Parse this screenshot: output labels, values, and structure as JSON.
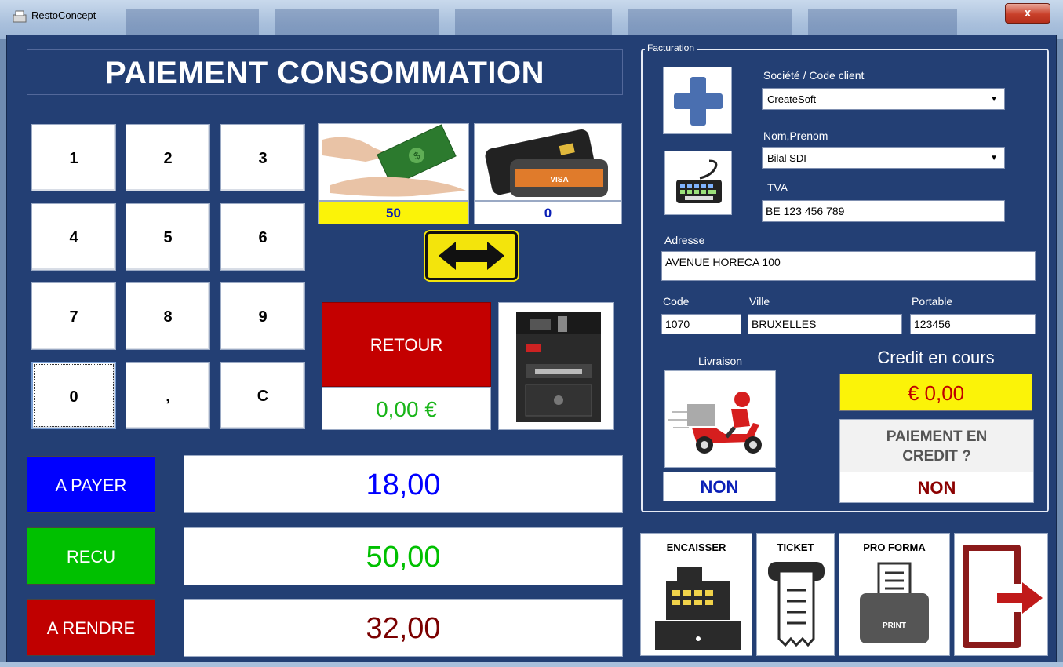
{
  "window": {
    "title": "RestoConcept",
    "close_glyph": "x"
  },
  "page_title": "PAIEMENT CONSOMMATION",
  "keypad": [
    "1",
    "2",
    "3",
    "4",
    "5",
    "6",
    "7",
    "8",
    "9",
    "0",
    ",",
    "C"
  ],
  "payment": {
    "cash_value": "50",
    "card_value": "0",
    "card_brand": "VISA",
    "retour_label": "RETOUR",
    "retour_value": "0,00 €"
  },
  "totals": {
    "a_payer_label": "A PAYER",
    "a_payer_value": "18,00",
    "recu_label": "RECU",
    "recu_value": "50,00",
    "a_rendre_label": "A RENDRE",
    "a_rendre_value": "32,00"
  },
  "facturation": {
    "legend": "Facturation",
    "societe_label": "Société / Code client",
    "societe_value": "CreateSoft",
    "nom_label": "Nom,Prenom",
    "nom_value": "Bilal SDI",
    "tva_label": "TVA",
    "tva_value": "BE 123 456 789",
    "adresse_label": "Adresse",
    "adresse_value": "AVENUE HORECA 100",
    "code_label": "Code",
    "code_value": "1070",
    "ville_label": "Ville",
    "ville_value": "BRUXELLES",
    "portable_label": "Portable",
    "portable_value": "123456",
    "livraison_label": "Livraison",
    "livraison_value": "NON",
    "credit_label": "Credit en cours",
    "credit_value": "€ 0,00",
    "credit_question_line1": "PAIEMENT EN",
    "credit_question_line2": "CREDIT ?",
    "credit_choice": "NON"
  },
  "actions": {
    "encaisser": "ENCAISSER",
    "ticket": "TICKET",
    "pro_forma": "PRO FORMA",
    "print_text": "PRINT"
  },
  "colors": {
    "background": "#233f74",
    "a_payer": "#0000ff",
    "recu": "#00c000",
    "a_rendre": "#c00000",
    "highlight_yellow": "#fbf308"
  }
}
